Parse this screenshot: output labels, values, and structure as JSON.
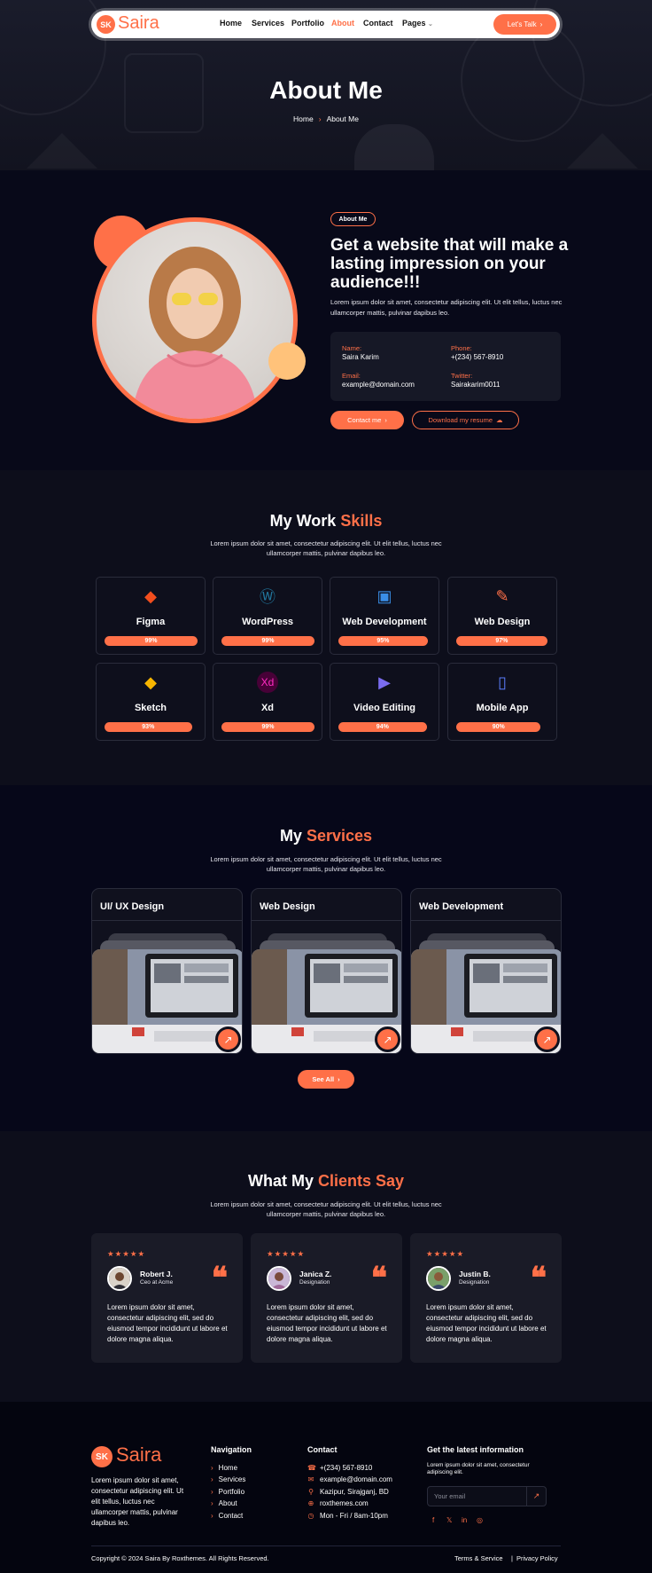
{
  "brand": {
    "badge": "SK",
    "name": "Saira",
    "accent": "#ff7048"
  },
  "nav": {
    "items": [
      {
        "label": "Home",
        "active": false
      },
      {
        "label": "Services",
        "active": false
      },
      {
        "label": "Portfolio",
        "active": false
      },
      {
        "label": "About",
        "active": true
      },
      {
        "label": "Contact",
        "active": false
      },
      {
        "label": "Pages",
        "active": false
      }
    ],
    "cta": "Let's Talk"
  },
  "hero": {
    "title": "About Me",
    "breadcrumb": [
      "Home",
      "About Me"
    ]
  },
  "about": {
    "badge": "About Me",
    "heading": "Get a website that will make a lasting impression on your audience!!!",
    "text": "Lorem ipsum dolor sit amet, consectetur adipiscing elit. Ut elit tellus, luctus nec ullamcorper mattis, pulvinar dapibus leo.",
    "info": [
      {
        "label": "Name:",
        "value": "Saira Karim"
      },
      {
        "label": "Phone:",
        "value": "+(234) 567-8910"
      },
      {
        "label": "Email:",
        "value": "example@domain.com"
      },
      {
        "label": "Twitter:",
        "value": "Sairakarim0011"
      }
    ],
    "contact_btn": "Contact me",
    "resume_btn": "Download my resume"
  },
  "skills": {
    "title_plain": "My Work",
    "title_accent": "Skills",
    "subtitle": "Lorem ipsum dolor sit amet, consectetur adipiscing elit. Ut elit tellus, luctus nec ullamcorper mattis, pulvinar dapibus leo.",
    "items": [
      {
        "name": "Figma",
        "percent": "99%",
        "level": 0.99,
        "icon": "figma-icon"
      },
      {
        "name": "WordPress",
        "percent": "99%",
        "level": 0.99,
        "icon": "wordpress-icon"
      },
      {
        "name": "Web Development",
        "percent": "95%",
        "level": 0.95,
        "icon": "web-development-icon"
      },
      {
        "name": "Web Design",
        "percent": "97%",
        "level": 0.97,
        "icon": "web-design-icon"
      },
      {
        "name": "Sketch",
        "percent": "93%",
        "level": 0.93,
        "icon": "sketch-icon"
      },
      {
        "name": "Xd",
        "percent": "99%",
        "level": 0.99,
        "icon": "xd-icon"
      },
      {
        "name": "Video Editing",
        "percent": "94%",
        "level": 0.94,
        "icon": "video-editing-icon"
      },
      {
        "name": "Mobile App",
        "percent": "90%",
        "level": 0.9,
        "icon": "mobile-app-icon"
      }
    ]
  },
  "services": {
    "title_plain": "My",
    "title_accent": "Services",
    "subtitle": "Lorem ipsum dolor sit amet, consectetur adipiscing elit. Ut elit tellus, luctus nec ullamcorper mattis, pulvinar dapibus leo.",
    "items": [
      {
        "title": "UI/ UX Design"
      },
      {
        "title": "Web Design"
      },
      {
        "title": "Web Development"
      }
    ],
    "see_all": "See All"
  },
  "clients": {
    "title_plain": "What My",
    "title_accent": "Clients Say",
    "subtitle": "Lorem ipsum dolor sit amet, consectetur adipiscing elit. Ut elit tellus, luctus nec ullamcorper mattis, pulvinar dapibus leo.",
    "stars": "★★★★★",
    "items": [
      {
        "name": "Robert J.",
        "role": "Ceo at Acme",
        "text": "Lorem ipsum dolor sit amet, consectetur adipiscing elit, sed do eiusmod tempor incididunt ut labore et dolore magna aliqua."
      },
      {
        "name": "Janica Z.",
        "role": "Designation",
        "text": "Lorem ipsum dolor sit amet, consectetur adipiscing elit, sed do eiusmod tempor incididunt ut labore et dolore magna aliqua."
      },
      {
        "name": "Justin B.",
        "role": "Designation",
        "text": "Lorem ipsum dolor sit amet, consectetur adipiscing elit, sed do eiusmod tempor incididunt ut labore et dolore magna aliqua."
      }
    ]
  },
  "footer": {
    "about": "Lorem ipsum dolor sit amet, consectetur adipiscing elit. Ut elit tellus, luctus nec ullamcorper mattis, pulvinar dapibus leo.",
    "nav_heading": "Navigation",
    "nav_links": [
      "Home",
      "Services",
      "Portfolio",
      "About",
      "Contact"
    ],
    "contact_heading": "Contact",
    "contact_items": [
      {
        "icon": "phone-icon",
        "text": "+(234) 567-8910"
      },
      {
        "icon": "email-icon",
        "text": "example@domain.com"
      },
      {
        "icon": "location-icon",
        "text": "Kazipur, Sirajganj, BD"
      },
      {
        "icon": "globe-icon",
        "text": "roxthemes.com"
      },
      {
        "icon": "clock-icon",
        "text": "Mon - Fri / 8am-10pm"
      }
    ],
    "news_heading": "Get the latest information",
    "news_text": "Lorem ipsum dolor sit amet, consectetur adipiscing elit.",
    "email_placeholder": "Your email",
    "socials": [
      "facebook-icon",
      "x-icon",
      "linkedin-icon",
      "instagram-icon"
    ],
    "copyright": "Copyright © 2024 Saira By Roxthemes. All Rights Reserved.",
    "terms": "Terms & Service",
    "privacy": "Privacy Policy"
  }
}
